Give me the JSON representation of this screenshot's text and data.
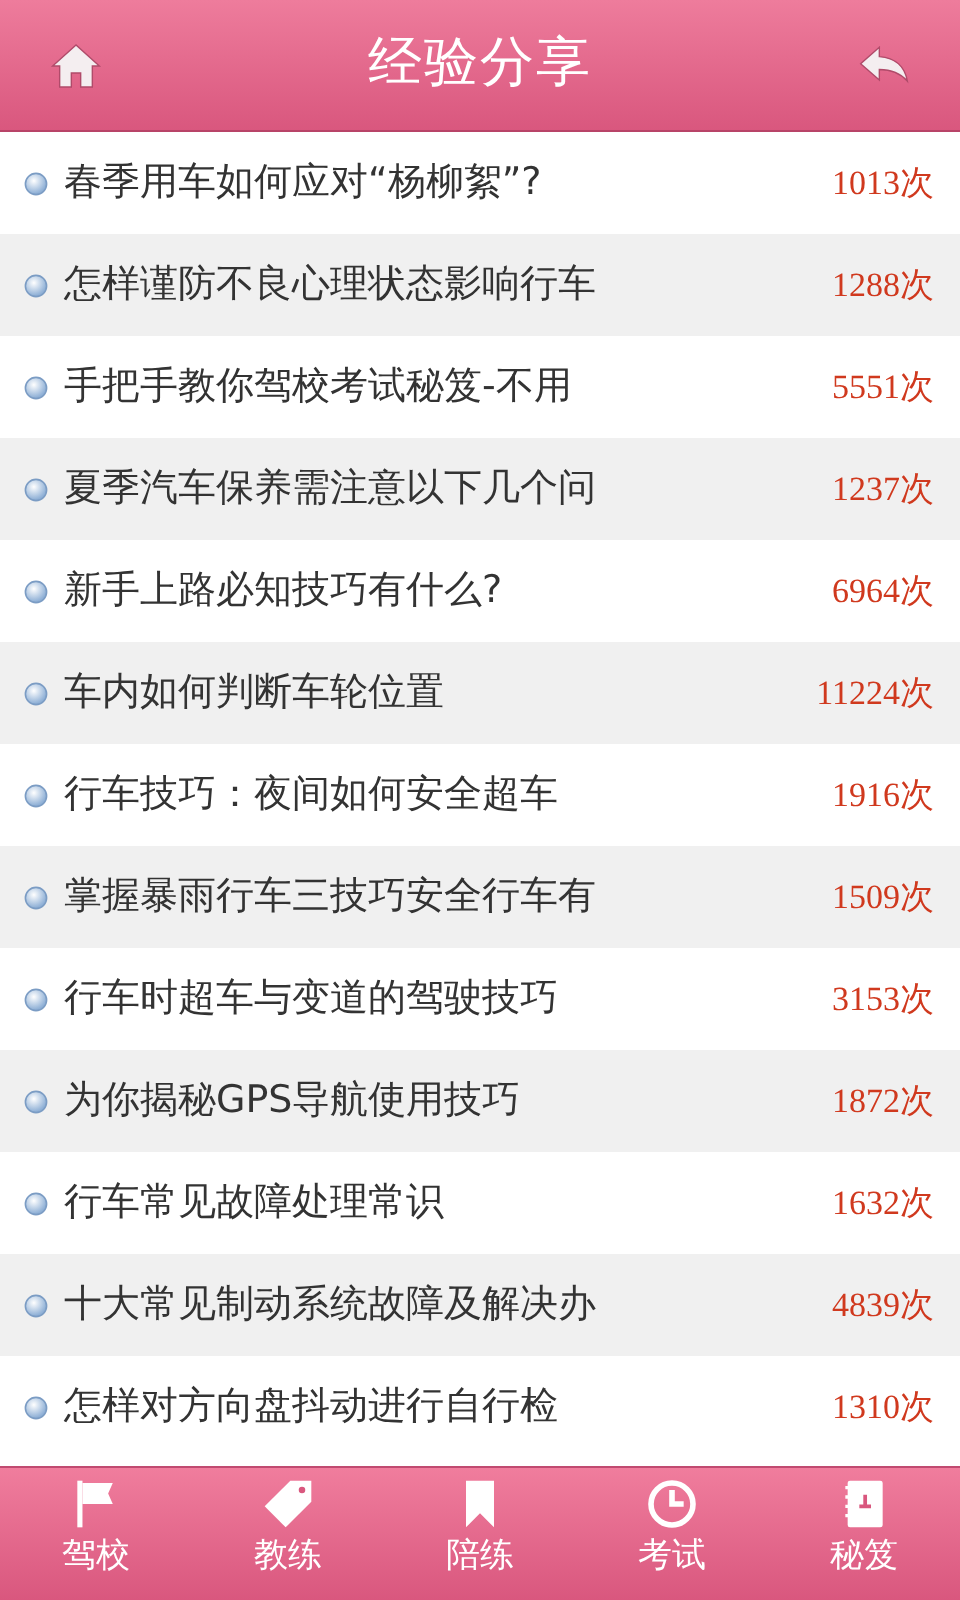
{
  "header": {
    "title": "经验分享"
  },
  "articles": [
    {
      "title": "春季用车如何应对“杨柳絮”?",
      "views": "1013次"
    },
    {
      "title": "怎样谨防不良心理状态影响行车",
      "views": "1288次"
    },
    {
      "title": "手把手教你驾校考试秘笈-不用",
      "views": "5551次"
    },
    {
      "title": "夏季汽车保养需注意以下几个问",
      "views": "1237次"
    },
    {
      "title": "新手上路必知技巧有什么?",
      "views": "6964次"
    },
    {
      "title": "车内如何判断车轮位置",
      "views": "11224次"
    },
    {
      "title": "行车技巧：夜间如何安全超车",
      "views": "1916次"
    },
    {
      "title": "掌握暴雨行车三技巧安全行车有",
      "views": "1509次"
    },
    {
      "title": "行车时超车与变道的驾驶技巧",
      "views": "3153次"
    },
    {
      "title": "为你揭秘GPS导航使用技巧",
      "views": "1872次"
    },
    {
      "title": "行车常见故障处理常识",
      "views": "1632次"
    },
    {
      "title": "十大常见制动系统故障及解决办",
      "views": "4839次"
    },
    {
      "title": "怎样对方向盘抖动进行自行检",
      "views": "1310次"
    }
  ],
  "tabbar": [
    {
      "label": "驾校",
      "kind": "flag"
    },
    {
      "label": "教练",
      "kind": "tag"
    },
    {
      "label": "陪练",
      "kind": "bookmark"
    },
    {
      "label": "考试",
      "kind": "clock"
    },
    {
      "label": "秘笈",
      "kind": "notebook"
    }
  ]
}
